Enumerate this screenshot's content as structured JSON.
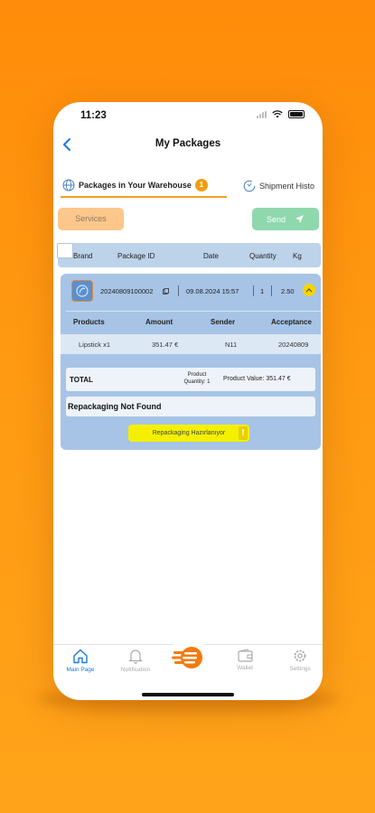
{
  "status": {
    "time": "11:23"
  },
  "nav": {
    "title": "My Packages"
  },
  "tabs": {
    "warehouse_label": "Packages in Your Warehouse",
    "warehouse_count": "1",
    "history_label": "Shipment Histo"
  },
  "actions": {
    "services_label": "Services",
    "send_label": "Send"
  },
  "table": {
    "headers": {
      "brand": "Brand",
      "package_id": "Package ID",
      "date": "Date",
      "quantity": "Quantity",
      "kg": "Kg"
    }
  },
  "package": {
    "package_id": "20240809100002",
    "date": "09.08.2024 15:57",
    "quantity": "1",
    "kg": "2.50",
    "products_headers": {
      "products": "Products",
      "amount": "Amount",
      "sender": "Sender",
      "acceptance": "Acceptance"
    },
    "products": [
      {
        "name": "Lipstick x1",
        "amount": "351.47 €",
        "sender": "N11",
        "acceptance": "20240809"
      }
    ],
    "total_label": "TOTAL",
    "product_quantity_label": "Product",
    "product_quantity_value": "Quantity: 1",
    "product_value": "Product Value: 351.47 €",
    "repackaging_status": "Repackaging Not Found",
    "repackaging_button": "Repackaging Hazırlanıyor",
    "warning_glyph": "!"
  },
  "bottom_tabs": {
    "main_page": "Main Page",
    "notification": "Notification",
    "wallet": "Wallet",
    "settings": "Settings"
  },
  "colors": {
    "background": "#ff8c0a",
    "accent_blue": "#1a7ae0",
    "card_blue": "#a7c4e6",
    "services_orange": "#fcc78a",
    "send_green": "#8fd8ae",
    "badge_orange": "#f39c12",
    "highlight_yellow": "#f5f000"
  },
  "icons": {
    "back": "chevron-left-icon",
    "warehouse": "globe-icon",
    "history": "refresh-icon",
    "send": "paper-plane-icon",
    "info": "info-icon",
    "home": "home-icon",
    "notification": "bell-icon",
    "logo": "brand-logo-icon",
    "wallet": "wallet-icon",
    "settings": "gear-icon"
  }
}
